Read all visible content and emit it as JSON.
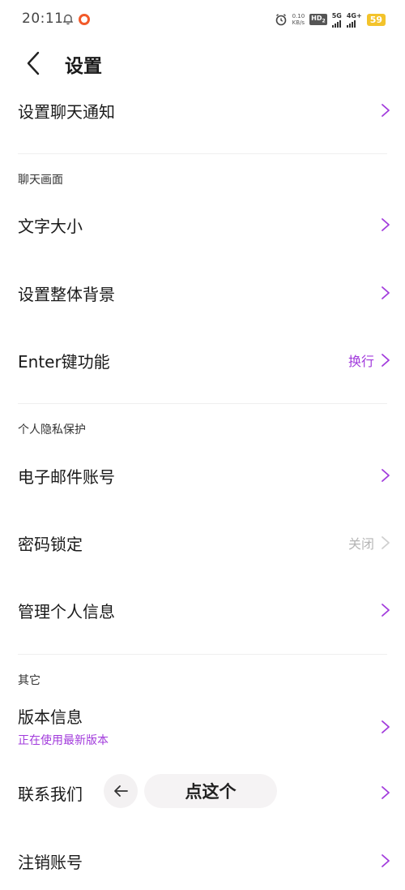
{
  "status_bar": {
    "time": "20:11",
    "net_speed_value": "0.10",
    "net_speed_unit": "KB/s",
    "hd_label": "HD",
    "hd_sub": "2",
    "signal1_label": "5G",
    "signal2_label": "4G+",
    "battery": "59"
  },
  "header": {
    "title": "设置"
  },
  "rows": {
    "chat_notify": {
      "label": "设置聊天通知"
    },
    "font_size": {
      "label": "文字大小"
    },
    "background": {
      "label": "设置整体背景"
    },
    "enter_key": {
      "label": "Enter键功能",
      "value": "换行"
    },
    "email": {
      "label": "电子邮件账号"
    },
    "password_lock": {
      "label": "密码锁定",
      "value": "关闭"
    },
    "personal_info": {
      "label": "管理个人信息"
    },
    "version": {
      "label": "版本信息",
      "sub": "正在使用最新版本"
    },
    "contact": {
      "label": "联系我们"
    },
    "deactivate": {
      "label": "注销账号"
    }
  },
  "sections": {
    "chat_screen": "聊天画面",
    "privacy": "个人隐私保护",
    "other": "其它"
  },
  "overlay": {
    "pill_label": "点这个"
  },
  "colors": {
    "accent": "#a23bdc",
    "muted": "#b5b5b5",
    "chevron": "#a23bdc",
    "chevron_disabled": "#cfcfcf"
  }
}
